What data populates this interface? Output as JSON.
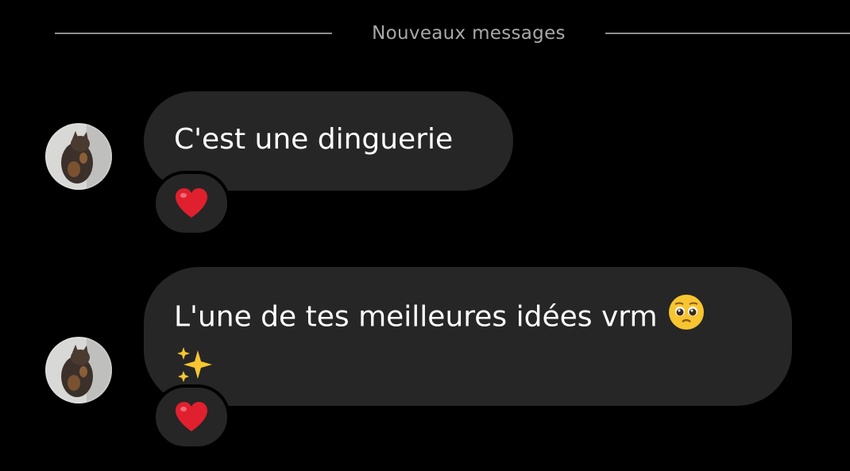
{
  "divider": {
    "label": "Nouveaux messages"
  },
  "messages": [
    {
      "text": "C'est une dinguerie",
      "reaction": "heart-emoji"
    },
    {
      "text": "L'une de tes meilleures idées vrm",
      "trailing_emojis": [
        "pleading-face-emoji",
        "sparkles-emoji"
      ],
      "reaction": "heart-emoji"
    }
  ],
  "colors": {
    "background": "#000000",
    "bubble": "#262626",
    "divider_text": "#a8a8a8",
    "divider_line": "#8e8e8e",
    "heart": "#e0202e"
  }
}
